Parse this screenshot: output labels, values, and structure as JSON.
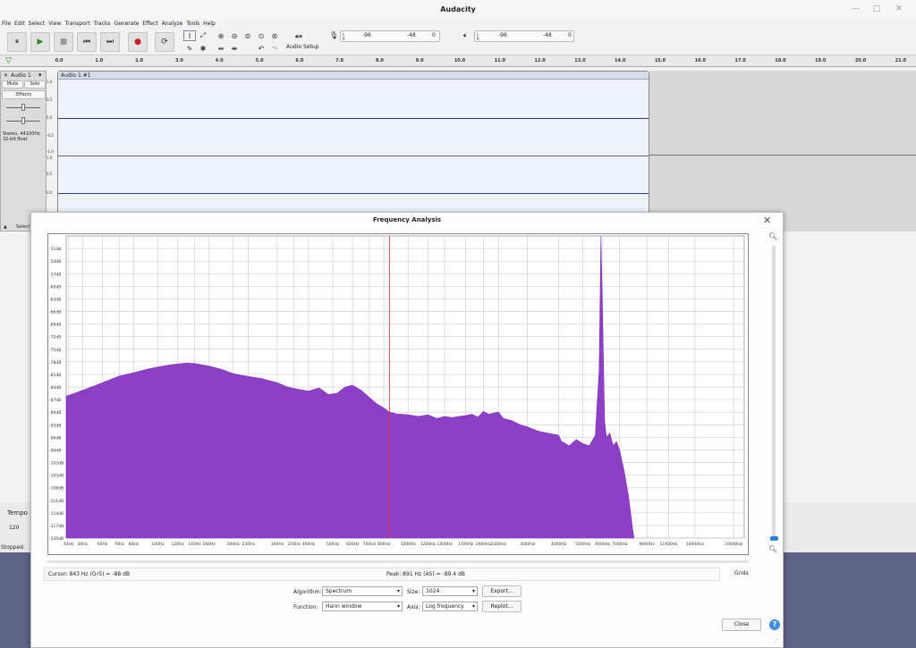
{
  "window": {
    "title": "Audacity",
    "controls": [
      "—",
      "□",
      "✕"
    ]
  },
  "menu": [
    "File",
    "Edit",
    "Select",
    "View",
    "Transport",
    "Tracks",
    "Generate",
    "Effect",
    "Analyze",
    "Tools",
    "Help"
  ],
  "transport_icons": [
    "⏸",
    "▶",
    "■",
    "⏮",
    "⏭",
    "●",
    "⟳"
  ],
  "audio_setup": {
    "label": "Audio Setup"
  },
  "meters": [
    {
      "lr": "L\nR",
      "ticks": [
        "-96",
        "-48",
        "0"
      ]
    },
    {
      "lr": "L\nR",
      "ticks": [
        "-96",
        "-48",
        "0"
      ]
    }
  ],
  "ruler": [
    "0.0",
    "1.0",
    "2.0",
    "3.0",
    "4.0",
    "5.0",
    "6.0",
    "7.0",
    "8.0",
    "9.0",
    "10.0",
    "11.0",
    "12.0",
    "13.0",
    "14.0",
    "15.0",
    "16.0",
    "17.0",
    "18.0",
    "19.0",
    "20.0",
    "21.0"
  ],
  "track": {
    "name": "Audio 1",
    "clip_name": "Audio 1 #1",
    "mute": "Mute",
    "solo": "Solo",
    "effects": "Effects",
    "info1": "Stereo, 44100Hz",
    "info2": "32-bit float",
    "select": "Select",
    "scale": [
      "1.0",
      "0.5",
      "0.0",
      "-0.5",
      "-1.0"
    ]
  },
  "bottom": {
    "tempo_label": "Tempo",
    "tempo_value": "120",
    "status": "Stopped."
  },
  "dialog": {
    "title": "Frequency Analysis",
    "cursor": "Cursor: 843 Hz (G♯5) = -88 dB",
    "peak": "Peak: 891 Hz (A5) = -89.4 dB",
    "grids": "Grids",
    "algorithm_label": "Algorithm:",
    "algorithm_value": "Spectrum",
    "size_label": "Size:",
    "size_value": "1024",
    "function_label": "Function:",
    "function_value": "Hann window",
    "axis_label": "Axis:",
    "axis_value": "Log frequency",
    "export": "Export...",
    "replot": "Replot...",
    "close": "Close",
    "help": "?"
  },
  "chart_data": {
    "type": "area",
    "title": "",
    "xscale": "log",
    "xlim": [
      43,
      22050
    ],
    "ylim": [
      -120,
      -48
    ],
    "yticks": [
      "-51dB",
      "-54dB",
      "-57dB",
      "-60dB",
      "-63dB",
      "-66dB",
      "-69dB",
      "-72dB",
      "-75dB",
      "-78dB",
      "-81dB",
      "-84dB",
      "-87dB",
      "-90dB",
      "-93dB",
      "-96dB",
      "-99dB",
      "-102dB",
      "-105dB",
      "-108dB",
      "-111dB",
      "-114dB",
      "-117dB",
      "-120dB"
    ],
    "xticks": [
      {
        "label": "44Hz",
        "v": 44
      },
      {
        "label": "50Hz",
        "v": 50
      },
      {
        "label": "60Hz",
        "v": 60
      },
      {
        "label": "70Hz",
        "v": 70
      },
      {
        "label": "80Hz",
        "v": 80
      },
      {
        "label": "100Hz",
        "v": 100
      },
      {
        "label": "120Hz",
        "v": 120
      },
      {
        "label": "140Hz",
        "v": 140
      },
      {
        "label": "160Hz",
        "v": 160
      },
      {
        "label": "200Hz",
        "v": 200
      },
      {
        "label": "230Hz",
        "v": 230
      },
      {
        "label": "300Hz",
        "v": 300
      },
      {
        "label": "350Hz",
        "v": 350
      },
      {
        "label": "400Hz",
        "v": 400
      },
      {
        "label": "500Hz",
        "v": 500
      },
      {
        "label": "600Hz",
        "v": 600
      },
      {
        "label": "700Hz",
        "v": 700
      },
      {
        "label": "800Hz",
        "v": 800
      },
      {
        "label": "1000Hz",
        "v": 1000
      },
      {
        "label": "1200Hz",
        "v": 1200
      },
      {
        "label": "1400Hz",
        "v": 1400
      },
      {
        "label": "1700Hz",
        "v": 1700
      },
      {
        "label": "2000Hz",
        "v": 2000
      },
      {
        "label": "2300Hz",
        "v": 2300
      },
      {
        "label": "3000Hz",
        "v": 3000
      },
      {
        "label": "4000Hz",
        "v": 4000
      },
      {
        "label": "5000Hz",
        "v": 5000
      },
      {
        "label": "6000Hz",
        "v": 6000
      },
      {
        "label": "7000Hz",
        "v": 7000
      },
      {
        "label": "9000Hz",
        "v": 9000
      },
      {
        "label": "11000Hz",
        "v": 11000
      },
      {
        "label": "14000Hz",
        "v": 14000
      },
      {
        "label": "20000Hz",
        "v": 20000
      }
    ],
    "cursor_hz": 843,
    "fill_color": "#8e3fc7",
    "x": [
      43,
      50,
      60,
      70,
      80,
      90,
      100,
      110,
      120,
      130,
      140,
      160,
      180,
      200,
      230,
      260,
      300,
      330,
      360,
      400,
      440,
      480,
      520,
      560,
      600,
      650,
      700,
      750,
      800,
      843,
      900,
      1000,
      1100,
      1200,
      1300,
      1400,
      1500,
      1600,
      1700,
      1800,
      1900,
      2000,
      2100,
      2200,
      2300,
      2400,
      2600,
      2800,
      3000,
      3300,
      3600,
      4000,
      4100,
      4200,
      4400,
      4700,
      5000,
      5300,
      5600,
      5800,
      5900,
      6000,
      6100,
      6200,
      6400,
      6600,
      6800,
      7000,
      7300,
      7600,
      7900,
      8000
    ],
    "values": [
      -86.2,
      -84.8,
      -83.0,
      -81.4,
      -80.6,
      -79.8,
      -79.2,
      -78.8,
      -78.5,
      -78.3,
      -78.4,
      -79.0,
      -79.8,
      -80.8,
      -81.5,
      -82.0,
      -83.0,
      -84.0,
      -84.5,
      -85.0,
      -84.2,
      -85.8,
      -85.5,
      -84.0,
      -83.6,
      -84.8,
      -86.5,
      -88.0,
      -89.0,
      -90.0,
      -90.4,
      -90.6,
      -91.0,
      -90.6,
      -91.5,
      -91.0,
      -91.3,
      -91.0,
      -90.8,
      -90.5,
      -91.2,
      -89.8,
      -90.5,
      -90.2,
      -90.0,
      -91.5,
      -92.0,
      -93.0,
      -93.5,
      -94.5,
      -95.0,
      -95.5,
      -97.0,
      -97.3,
      -98.0,
      -96.5,
      -97.5,
      -98.0,
      -95.5,
      -80.0,
      -48.0,
      -70.0,
      -92.0,
      -96.0,
      -95.0,
      -98.0,
      -97.0,
      -99.0,
      -104.0,
      -110.0,
      -118.0,
      -120.0
    ]
  }
}
